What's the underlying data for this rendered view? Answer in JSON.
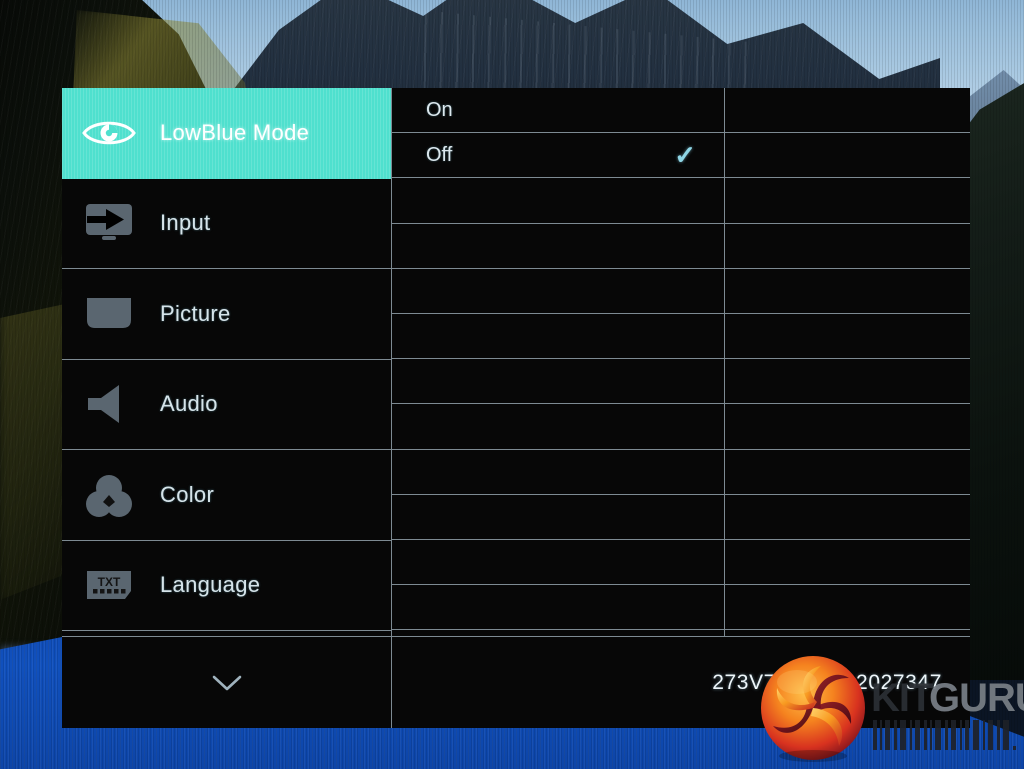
{
  "background": {
    "scene_description": "mountain fjord landscape with blue water",
    "sky_color": "#a9c9e2",
    "water_color": "#0f49b2"
  },
  "osd": {
    "accent_color": "#4fe0ce",
    "panel_color": "#070707",
    "divider_color": "#7d8a92",
    "categories": [
      {
        "label": "LowBlue Mode",
        "icon": "eye-icon",
        "selected": true
      },
      {
        "label": "Input",
        "icon": "input-icon",
        "selected": false
      },
      {
        "label": "Picture",
        "icon": "picture-icon",
        "selected": false
      },
      {
        "label": "Audio",
        "icon": "audio-icon",
        "selected": false
      },
      {
        "label": "Color",
        "icon": "color-icon",
        "selected": false
      },
      {
        "label": "Language",
        "icon": "txt-icon",
        "selected": false
      }
    ],
    "options": [
      {
        "label": "On",
        "checked": false,
        "check_glyph": ""
      },
      {
        "label": "Off",
        "checked": true,
        "check_glyph": "✓"
      }
    ],
    "submenu_rows": 13,
    "footer": {
      "scroll_down_icon": "chevron-down-icon",
      "model_text": "273V7 SN        1712027347"
    }
  },
  "watermark": {
    "kit_text": "KIT",
    "guru_text": "GURU",
    "logo_name": "kitguru-swirl-logo"
  }
}
